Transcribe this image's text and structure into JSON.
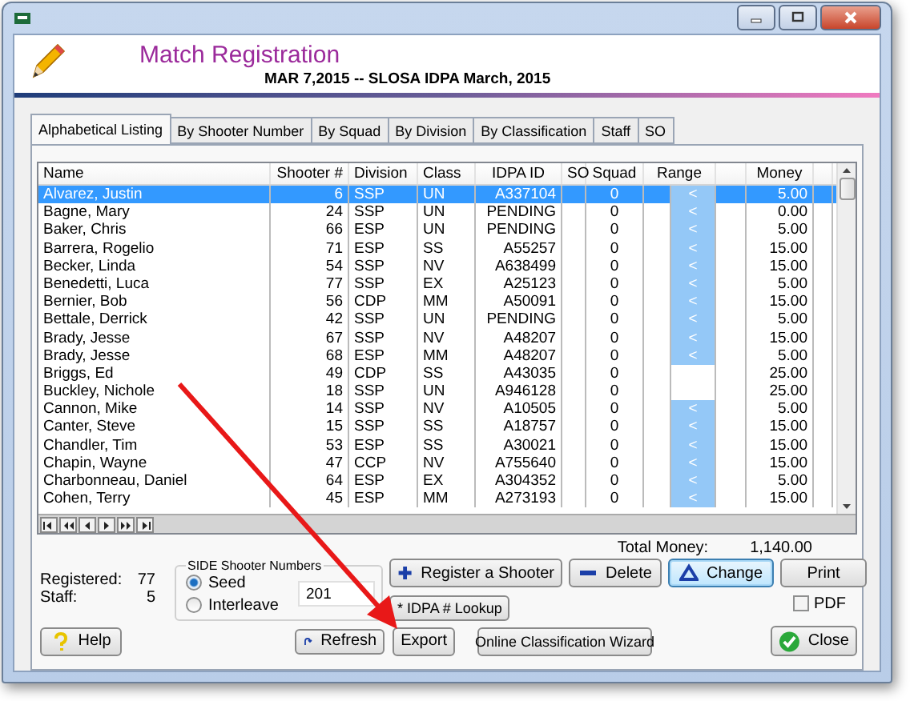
{
  "header": {
    "title": "Match Registration",
    "subtitle": "MAR  7,2015 -- SLOSA IDPA March, 2015"
  },
  "tabs": [
    {
      "label": "Alphabetical Listing",
      "selected": true
    },
    {
      "label": "By Shooter Number",
      "selected": false
    },
    {
      "label": "By Squad",
      "selected": false
    },
    {
      "label": "By Division",
      "selected": false
    },
    {
      "label": "By Classification",
      "selected": false
    },
    {
      "label": "Staff",
      "selected": false
    },
    {
      "label": "SO",
      "selected": false
    }
  ],
  "table": {
    "columns": [
      "Name",
      "Shooter #",
      "Division",
      "Class",
      "IDPA ID",
      "SO",
      "Squad",
      "Range",
      "Money"
    ],
    "rows": [
      {
        "name": "Alvarez, Justin",
        "number": "6",
        "division": "SSP",
        "class": "UN",
        "idpa_id": "A337104",
        "squad": "0",
        "range": "<",
        "money": "5.00",
        "selected": true
      },
      {
        "name": "Bagne, Mary",
        "number": "24",
        "division": "SSP",
        "class": "UN",
        "idpa_id": "PENDING",
        "squad": "0",
        "range": "<",
        "money": "0.00",
        "selected": false
      },
      {
        "name": "Baker, Chris",
        "number": "66",
        "division": "ESP",
        "class": "UN",
        "idpa_id": "PENDING",
        "squad": "0",
        "range": "<",
        "money": "5.00",
        "selected": false
      },
      {
        "name": "Barrera, Rogelio",
        "number": "71",
        "division": "ESP",
        "class": "SS",
        "idpa_id": "A55257",
        "squad": "0",
        "range": "<",
        "money": "15.00",
        "selected": false
      },
      {
        "name": "Becker, Linda",
        "number": "54",
        "division": "SSP",
        "class": "NV",
        "idpa_id": "A638499",
        "squad": "0",
        "range": "<",
        "money": "15.00",
        "selected": false
      },
      {
        "name": "Benedetti, Luca",
        "number": "77",
        "division": "SSP",
        "class": "EX",
        "idpa_id": "A25123",
        "squad": "0",
        "range": "<",
        "money": "5.00",
        "selected": false
      },
      {
        "name": "Bernier, Bob",
        "number": "56",
        "division": "CDP",
        "class": "MM",
        "idpa_id": "A50091",
        "squad": "0",
        "range": "<",
        "money": "15.00",
        "selected": false
      },
      {
        "name": "Bettale, Derrick",
        "number": "42",
        "division": "SSP",
        "class": "UN",
        "idpa_id": "PENDING",
        "squad": "0",
        "range": "<",
        "money": "5.00",
        "selected": false
      },
      {
        "name": "Brady, Jesse",
        "number": "67",
        "division": "SSP",
        "class": "NV",
        "idpa_id": "A48207",
        "squad": "0",
        "range": "<",
        "money": "15.00",
        "selected": false
      },
      {
        "name": "Brady, Jesse",
        "number": "68",
        "division": "ESP",
        "class": "MM",
        "idpa_id": "A48207",
        "squad": "0",
        "range": "<",
        "money": "5.00",
        "selected": false
      },
      {
        "name": "Briggs, Ed",
        "number": "49",
        "division": "CDP",
        "class": "SS",
        "idpa_id": "A43035",
        "squad": "0",
        "money": "25.00",
        "selected": false
      },
      {
        "name": "Buckley, Nichole",
        "number": "18",
        "division": "SSP",
        "class": "UN",
        "idpa_id": "A946128",
        "squad": "0",
        "money": "25.00",
        "selected": false
      },
      {
        "name": "Cannon, Mike",
        "number": "14",
        "division": "SSP",
        "class": "NV",
        "idpa_id": "A10505",
        "squad": "0",
        "range": "<",
        "money": "5.00",
        "selected": false
      },
      {
        "name": "Canter, Steve",
        "number": "15",
        "division": "SSP",
        "class": "SS",
        "idpa_id": "A18757",
        "squad": "0",
        "range": "<",
        "money": "15.00",
        "selected": false
      },
      {
        "name": "Chandler, Tim",
        "number": "53",
        "division": "ESP",
        "class": "SS",
        "idpa_id": "A30021",
        "squad": "0",
        "range": "<",
        "money": "15.00",
        "selected": false
      },
      {
        "name": "Chapin, Wayne",
        "number": "47",
        "division": "CCP",
        "class": "NV",
        "idpa_id": "A755640",
        "squad": "0",
        "range": "<",
        "money": "15.00",
        "selected": false
      },
      {
        "name": "Charbonneau, Daniel",
        "number": "64",
        "division": "ESP",
        "class": "EX",
        "idpa_id": "A304352",
        "squad": "0",
        "range": "<",
        "money": "5.00",
        "selected": false
      },
      {
        "name": "Cohen, Terry",
        "number": "45",
        "division": "ESP",
        "class": "MM",
        "idpa_id": "A273193",
        "squad": "0",
        "range": "<",
        "money": "15.00",
        "selected": false
      }
    ]
  },
  "total": {
    "label": "Total Money:",
    "value": "1,140.00"
  },
  "stats": [
    {
      "label": "Registered:",
      "value": "77"
    },
    {
      "label": "Staff:",
      "value": "5"
    }
  ],
  "side_numbers": {
    "title": "SIDE Shooter Numbers",
    "options": [
      {
        "label": "Seed",
        "selected": true
      },
      {
        "label": "Interleave",
        "selected": false
      }
    ],
    "value": "201"
  },
  "buttons": {
    "register": "Register a Shooter",
    "delete": "Delete",
    "change": "Change",
    "print": "Print",
    "lookup": "* IDPA # Lookup",
    "help": "Help",
    "refresh": "Refresh",
    "export": "Export",
    "wizard": "Online Classification Wizard",
    "close": "Close"
  },
  "pdf": {
    "label": "PDF",
    "checked": false
  }
}
